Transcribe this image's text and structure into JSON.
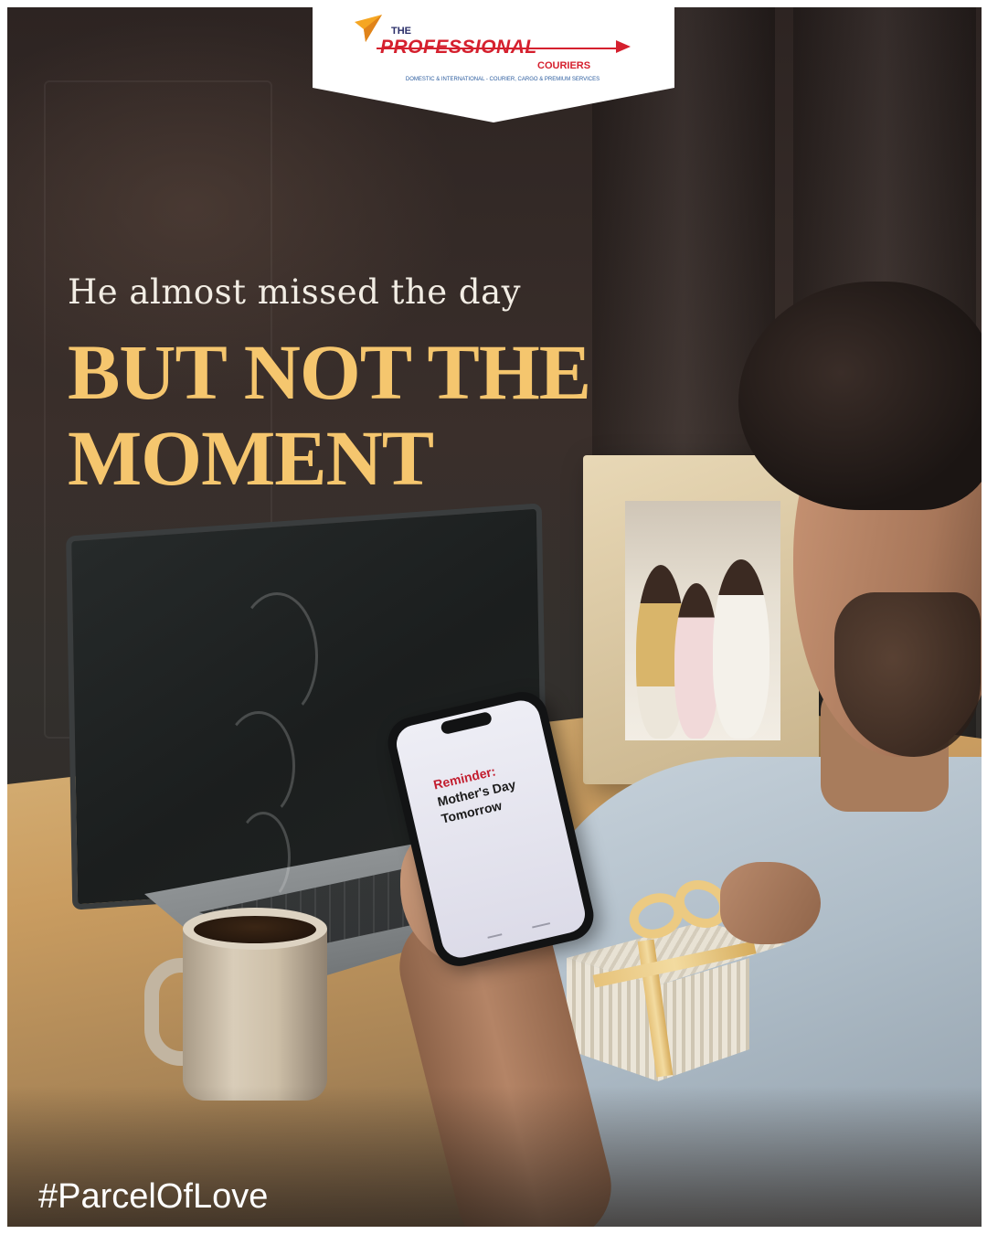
{
  "brand": {
    "the": "THE",
    "name": "PROFESSIONAL",
    "couriers": "COURIERS",
    "tagline": "DOMESTIC & INTERNATIONAL - COURIER, CARGO & PREMIUM SERVICES",
    "colors": {
      "red": "#d5202e",
      "navy": "#2b2f6a",
      "gold": "#f5a623"
    }
  },
  "headline": {
    "line1": "He almost missed the day",
    "line2": "BUT NOT THE MOMENT",
    "accent_color": "#f5c66e"
  },
  "phone": {
    "reminder_title": "Reminder:",
    "reminder_body": "Mother's Day Tomorrow"
  },
  "hashtag": "#ParcelOfLove"
}
